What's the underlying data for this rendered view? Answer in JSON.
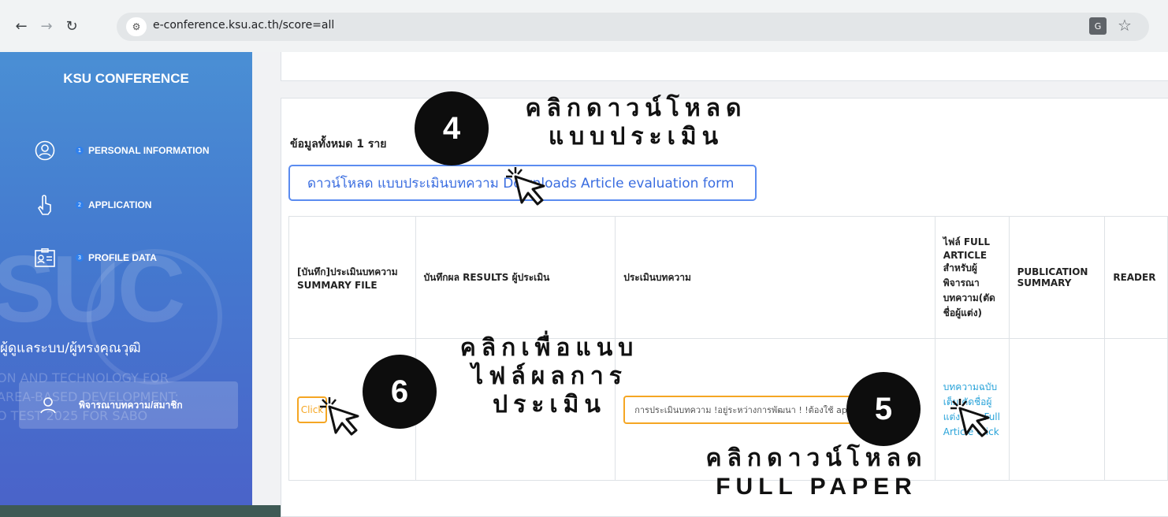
{
  "browser": {
    "url": "e-conference.ksu.ac.th/score=all",
    "back_icon": "arrow-left-icon",
    "forward_icon": "arrow-right-icon",
    "reload_icon": "reload-icon"
  },
  "sidebar": {
    "brand": "KSU CONFERENCE",
    "watermark": "SUC",
    "items": [
      {
        "num": "1",
        "label": "PERSONAL INFORMATION",
        "icon": "user-circle-icon"
      },
      {
        "num": "2",
        "label": "APPLICATION",
        "icon": "hand-pointer-icon"
      },
      {
        "num": "3",
        "label": "PROFILE DATA",
        "icon": "id-card-icon"
      }
    ],
    "role": "ผู้ดูแลระบบ/ผู้ทรงคุณวุฒิ",
    "bg_text_1": "ON AND TECHNOLOGY FOR",
    "bg_text_2": "AREA-BASED DEVELOPMENT:",
    "bg_text_3": "O TEST 2025 FOR SABO",
    "reviewer_label": "พิจารณาบทความ/สมาชิก"
  },
  "main": {
    "total": "ข้อมูลทั้งหมด 1 ราย",
    "download_button": "ดาวน์โหลด แบบประเมินบทความ Downloads Article evaluation form",
    "headers": [
      "[บันทึก]ประเมินบทความ SUMMARY FILE",
      "บันทึกผล RESULTS ผู้ประเมิน",
      "ประเมินบทความ",
      "ไฟล์ FULL ARTICLE สำหรับผู้พิจารณาบทความ(ตัดชื่อผู้แต่ง)",
      "PUBLICATION SUMMARY",
      "READER"
    ],
    "row": {
      "click_button": "Click",
      "evaluation_button": "การประเมินบทความ !อยู่ระหว่างการพัฒนา ! !ต้องใช้ app",
      "file_link": "บทความฉบับเต็ม ตัดชื่อผู้แต่ง คลิก Full Article Click"
    }
  },
  "annotations": {
    "step4": {
      "num": "4",
      "text_line1": "คลิกดาวน์โหลด",
      "text_line2": "แบบประเมิน"
    },
    "step5": {
      "num": "5",
      "text_line1": "คลิกดาวน์โหลด",
      "text_line2": "FULL PAPER"
    },
    "step6": {
      "num": "6",
      "text_line1": "คลิกเพื่อแนบ",
      "text_line2": "ไฟล์ผลการ",
      "text_line3": "ประเมิน"
    }
  }
}
